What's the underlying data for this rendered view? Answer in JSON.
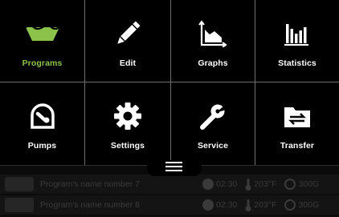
{
  "menu": {
    "tiles": [
      {
        "label": "Programs",
        "icon": "basin-icon",
        "active": true
      },
      {
        "label": "Edit",
        "icon": "pencil-icon",
        "active": false
      },
      {
        "label": "Graphs",
        "icon": "area-graph-icon",
        "active": false
      },
      {
        "label": "Statistics",
        "icon": "bar-chart-icon",
        "active": false
      },
      {
        "label": "Pumps",
        "icon": "pump-icon",
        "active": false
      },
      {
        "label": "Settings",
        "icon": "gear-icon",
        "active": false
      },
      {
        "label": "Service",
        "icon": "wrench-icon",
        "active": false
      },
      {
        "label": "Transfer",
        "icon": "folder-transfer-icon",
        "active": false
      }
    ],
    "active_color": "#8bc34a"
  },
  "programs": [
    {
      "name": "Program's name number 7",
      "time": "02:30",
      "temperature": "203°F",
      "speed": "300G"
    },
    {
      "name": "Program's name number 8",
      "time": "02:30",
      "temperature": "203°F",
      "speed": "300G"
    }
  ]
}
